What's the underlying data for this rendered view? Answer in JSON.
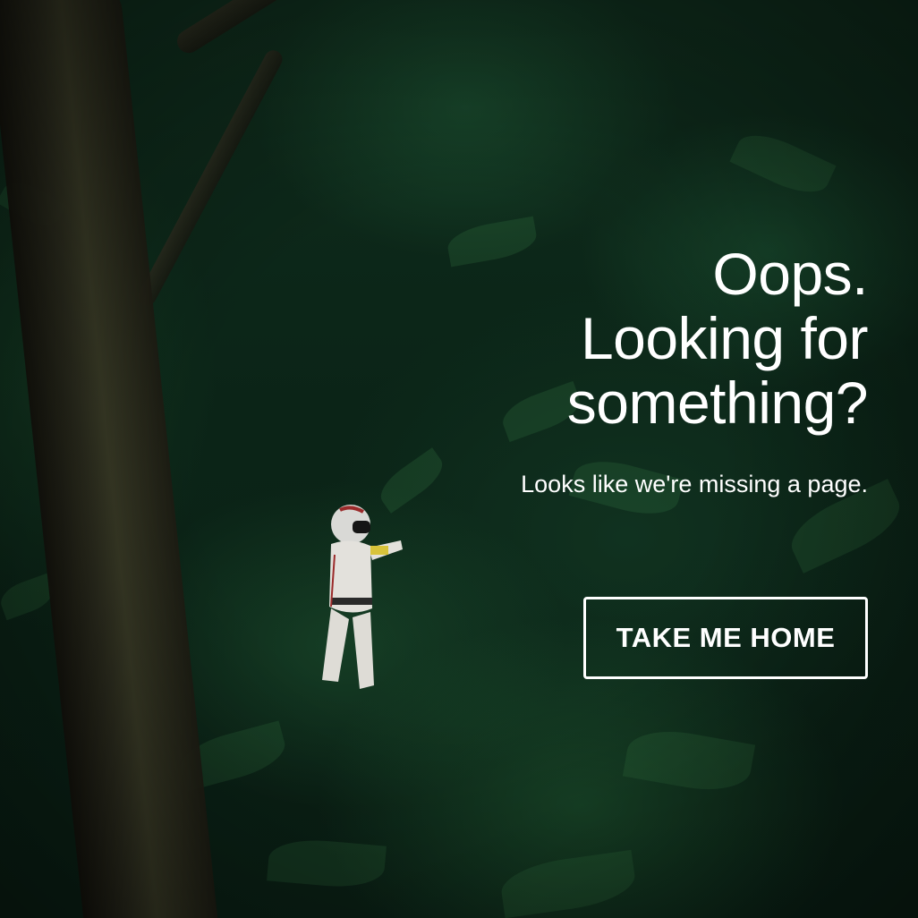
{
  "hero": {
    "headline_line1": "Oops.",
    "headline_line2": "Looking for",
    "headline_line3": "something?",
    "subtext": "Looks like we're missing a page."
  },
  "cta": {
    "label": "TAKE ME HOME"
  },
  "colors": {
    "text": "#ffffff",
    "background": "#0b2417",
    "button_border": "#ffffff"
  },
  "background_image": {
    "icon": "forest-astronaut-photo"
  }
}
